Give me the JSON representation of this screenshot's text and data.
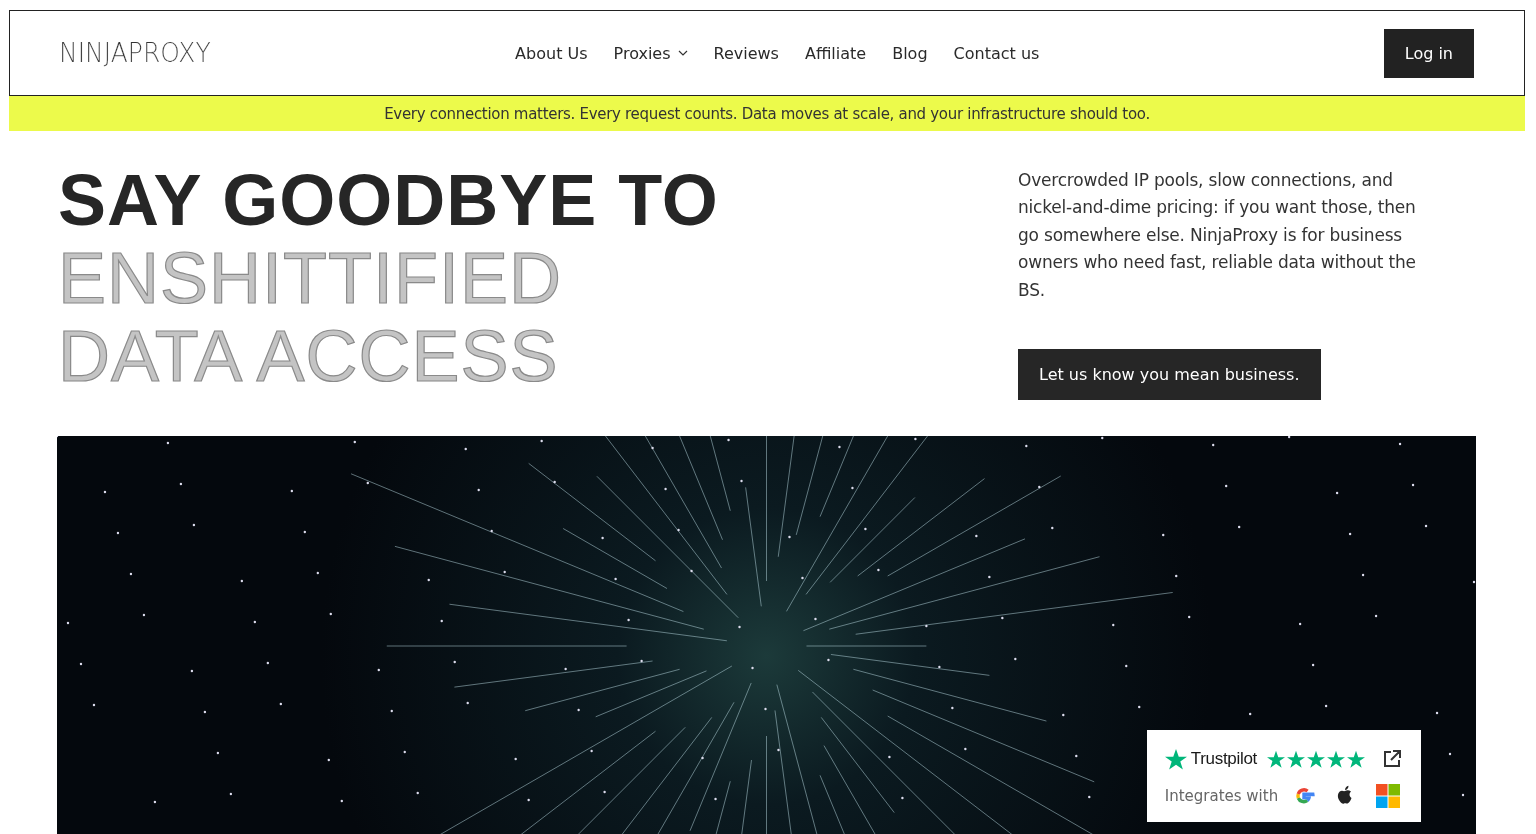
{
  "header": {
    "logo": "NINJAPROXY",
    "nav": [
      {
        "label": "About Us",
        "has_menu": false
      },
      {
        "label": "Proxies",
        "has_menu": true
      },
      {
        "label": "Reviews",
        "has_menu": false
      },
      {
        "label": "Affiliate",
        "has_menu": false
      },
      {
        "label": "Blog",
        "has_menu": false
      },
      {
        "label": "Contact us",
        "has_menu": false
      }
    ],
    "login": "Log in"
  },
  "banner": "Every connection matters. Every request counts. Data moves at scale, and your infrastructure should too.",
  "hero": {
    "headline": [
      {
        "text": "SAY GOODBYE TO",
        "kind": "solid"
      },
      {
        "text": "ENSHITTIFIED",
        "kind": "outline"
      },
      {
        "text": "DATA ACCESS",
        "kind": "outline"
      }
    ],
    "description": "Overcrowded IP pools, slow connections, and nickel-and-dime pricing: if you want those, then go somewhere else. NinjaProxy is for business owners who need fast, reliable data without the BS.",
    "cta": "Let us know you mean business."
  },
  "badge": {
    "brand": "Trustpilot",
    "stars": 5,
    "integrates": "Integrates with"
  }
}
